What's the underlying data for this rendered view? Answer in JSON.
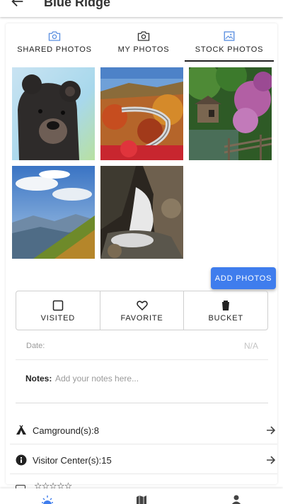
{
  "app_bar": {
    "title": "Blue Ridge",
    "back_icon": "arrow-left-icon"
  },
  "tabs": [
    {
      "label": "SHARED PHOTOS",
      "icon": "camera-icon",
      "icon_color": "#5b8fe0",
      "active": false
    },
    {
      "label": "MY PHOTOS",
      "icon": "camera-icon",
      "icon_color": "#333333",
      "active": false
    },
    {
      "label": "STOCK PHOTOS",
      "icon": "image-icon",
      "icon_color": "#5b8fe0",
      "active": true
    }
  ],
  "photos": [
    {
      "subject": "bear cub"
    },
    {
      "subject": "viaduct in autumn"
    },
    {
      "subject": "mill and flowers"
    },
    {
      "subject": "mountain vista"
    },
    {
      "subject": "waterfall"
    }
  ],
  "add_photos_label": "ADD PHOTOS",
  "actions": [
    {
      "label": "VISITED",
      "icon": "checkbox-icon"
    },
    {
      "label": "FAVORITE",
      "icon": "heart-icon"
    },
    {
      "label": "BUCKET",
      "icon": "bucket-icon"
    }
  ],
  "date": {
    "label": "Date:",
    "value": "N/A"
  },
  "notes": {
    "label": "Notes:",
    "placeholder": "Add your notes here..."
  },
  "info_rows": [
    {
      "text": "Camground(s):8",
      "icon": "tent-icon"
    },
    {
      "text": "Visitor Center(s):15",
      "icon": "info-icon"
    }
  ],
  "rating_stars": "☆☆☆☆☆",
  "bottom_nav": [
    {
      "icon": "sun-icon",
      "color": "#3f7ded"
    },
    {
      "icon": "map-icon",
      "color": "#444444"
    },
    {
      "icon": "person-icon",
      "color": "#444444"
    }
  ],
  "colors": {
    "accent": "#3f7ded"
  }
}
